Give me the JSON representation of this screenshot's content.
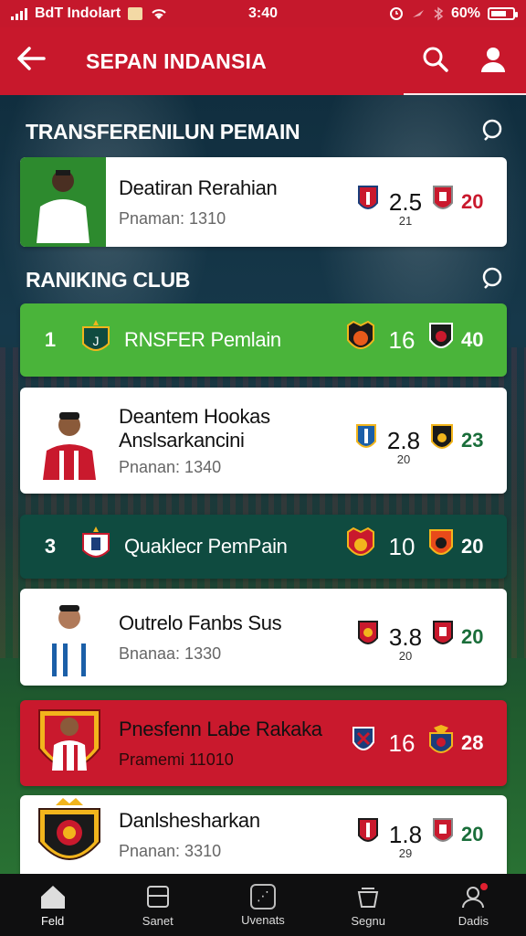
{
  "status_bar": {
    "carrier": "BdT Indolart",
    "time": "3:40",
    "battery": "60%"
  },
  "app_bar": {
    "title": "SEPAN INDANSIA"
  },
  "transfer_section": {
    "title": "TRANSFERENILUN PEMAIN",
    "card": {
      "name": "Deatiran Rerahian",
      "sub": "Pnaman: 1310",
      "value": "2.5",
      "value_sub": "21",
      "right_value": "20"
    }
  },
  "ranking_section": {
    "title": "RANIKING CLUB",
    "rows": [
      {
        "rank": "1",
        "name": "RNSFER Pemlain",
        "value": "16",
        "right_value": "40"
      },
      {
        "name": "Deantem Hookas",
        "name2": "Anslsarkancini",
        "sub": "Pnanan: 1340",
        "value": "2.8",
        "value_sub": "20",
        "right_value": "23"
      },
      {
        "rank": "3",
        "name": "Quaklecr PemPain",
        "value": "10",
        "right_value": "20"
      },
      {
        "name": "Outrelo Fanbs Sus",
        "sub": "Bnanaa: 1330",
        "value": "3.8",
        "value_sub": "20",
        "right_value": "20"
      },
      {
        "name": "Pnesfenn Labe Rakaka",
        "sub": "Pramemi 11010",
        "value": "16",
        "right_value": "28"
      },
      {
        "name": "Danlshesharkan",
        "sub": "Pnanan: 3310",
        "value": "1.8",
        "value_sub": "29",
        "right_value": "20"
      }
    ]
  },
  "bottom_nav": [
    {
      "label": "Feld",
      "icon": "home-icon"
    },
    {
      "label": "Sanet",
      "icon": "inbox-icon"
    },
    {
      "label": "Uvenats",
      "icon": "grid-icon"
    },
    {
      "label": "Segnu",
      "icon": "basket-icon"
    },
    {
      "label": "Dadis",
      "icon": "profile-icon"
    }
  ],
  "colors": {
    "header_red": "#c8182c",
    "green_row": "#4ab43a",
    "teal_row": "#0f4b40",
    "red_row": "#c9192d",
    "score_green": "#1a6e3a"
  }
}
